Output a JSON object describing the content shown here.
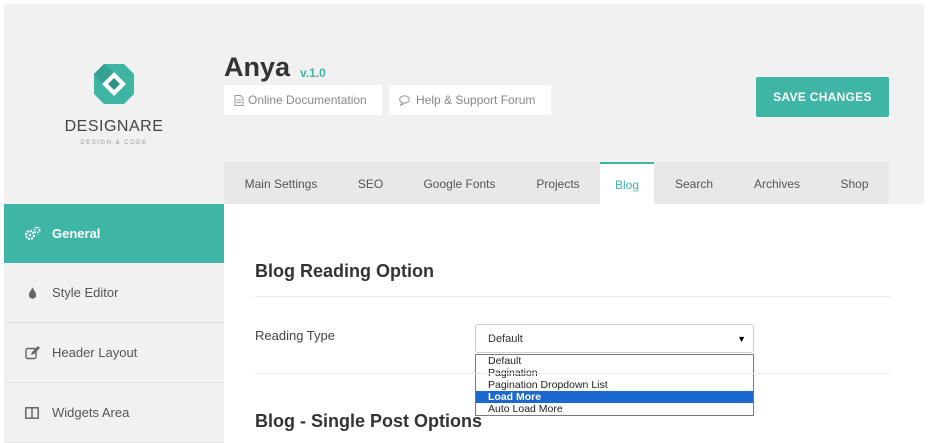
{
  "brand": {
    "name": "DESIGNARE",
    "tagline": "DESIGN & CODE",
    "accent": "#3fb5a6"
  },
  "header": {
    "title": "Anya",
    "version": "v.1.0",
    "docs_label": "Online Documentation",
    "support_label": "Help & Support Forum",
    "save_label": "SAVE CHANGES"
  },
  "tabs": [
    {
      "label": "Main Settings"
    },
    {
      "label": "SEO"
    },
    {
      "label": "Google Fonts"
    },
    {
      "label": "Projects"
    },
    {
      "label": "Blog",
      "active": true
    },
    {
      "label": "Search"
    },
    {
      "label": "Archives"
    },
    {
      "label": "Shop"
    }
  ],
  "sidebar": {
    "items": [
      {
        "label": "General",
        "icon": "gears-icon",
        "active": true
      },
      {
        "label": "Style Editor",
        "icon": "droplet-icon"
      },
      {
        "label": "Header Layout",
        "icon": "edit-icon"
      },
      {
        "label": "Widgets Area",
        "icon": "columns-icon"
      }
    ]
  },
  "main": {
    "section1_title": "Blog Reading Option",
    "reading_type_label": "Reading Type",
    "reading_type_value": "Default",
    "dropdown_options": [
      "Default",
      "Pagination",
      "Pagination Dropdown List",
      "Load More",
      "Auto Load More"
    ],
    "highlighted_option": "Load More",
    "section2_title": "Blog - Single Post Options"
  }
}
